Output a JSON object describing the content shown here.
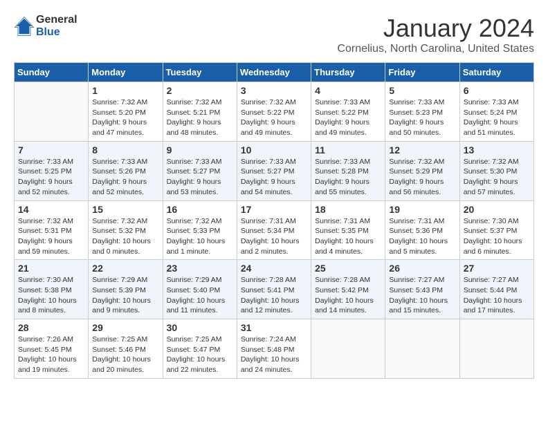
{
  "logo": {
    "text_general": "General",
    "text_blue": "Blue"
  },
  "title": "January 2024",
  "location": "Cornelius, North Carolina, United States",
  "days_of_week": [
    "Sunday",
    "Monday",
    "Tuesday",
    "Wednesday",
    "Thursday",
    "Friday",
    "Saturday"
  ],
  "weeks": [
    [
      {
        "day": "",
        "sunrise": "",
        "sunset": "",
        "daylight": ""
      },
      {
        "day": "1",
        "sunrise": "Sunrise: 7:32 AM",
        "sunset": "Sunset: 5:20 PM",
        "daylight": "Daylight: 9 hours and 47 minutes."
      },
      {
        "day": "2",
        "sunrise": "Sunrise: 7:32 AM",
        "sunset": "Sunset: 5:21 PM",
        "daylight": "Daylight: 9 hours and 48 minutes."
      },
      {
        "day": "3",
        "sunrise": "Sunrise: 7:32 AM",
        "sunset": "Sunset: 5:22 PM",
        "daylight": "Daylight: 9 hours and 49 minutes."
      },
      {
        "day": "4",
        "sunrise": "Sunrise: 7:33 AM",
        "sunset": "Sunset: 5:22 PM",
        "daylight": "Daylight: 9 hours and 49 minutes."
      },
      {
        "day": "5",
        "sunrise": "Sunrise: 7:33 AM",
        "sunset": "Sunset: 5:23 PM",
        "daylight": "Daylight: 9 hours and 50 minutes."
      },
      {
        "day": "6",
        "sunrise": "Sunrise: 7:33 AM",
        "sunset": "Sunset: 5:24 PM",
        "daylight": "Daylight: 9 hours and 51 minutes."
      }
    ],
    [
      {
        "day": "7",
        "sunrise": "Sunrise: 7:33 AM",
        "sunset": "Sunset: 5:25 PM",
        "daylight": "Daylight: 9 hours and 52 minutes."
      },
      {
        "day": "8",
        "sunrise": "Sunrise: 7:33 AM",
        "sunset": "Sunset: 5:26 PM",
        "daylight": "Daylight: 9 hours and 52 minutes."
      },
      {
        "day": "9",
        "sunrise": "Sunrise: 7:33 AM",
        "sunset": "Sunset: 5:27 PM",
        "daylight": "Daylight: 9 hours and 53 minutes."
      },
      {
        "day": "10",
        "sunrise": "Sunrise: 7:33 AM",
        "sunset": "Sunset: 5:27 PM",
        "daylight": "Daylight: 9 hours and 54 minutes."
      },
      {
        "day": "11",
        "sunrise": "Sunrise: 7:33 AM",
        "sunset": "Sunset: 5:28 PM",
        "daylight": "Daylight: 9 hours and 55 minutes."
      },
      {
        "day": "12",
        "sunrise": "Sunrise: 7:32 AM",
        "sunset": "Sunset: 5:29 PM",
        "daylight": "Daylight: 9 hours and 56 minutes."
      },
      {
        "day": "13",
        "sunrise": "Sunrise: 7:32 AM",
        "sunset": "Sunset: 5:30 PM",
        "daylight": "Daylight: 9 hours and 57 minutes."
      }
    ],
    [
      {
        "day": "14",
        "sunrise": "Sunrise: 7:32 AM",
        "sunset": "Sunset: 5:31 PM",
        "daylight": "Daylight: 9 hours and 59 minutes."
      },
      {
        "day": "15",
        "sunrise": "Sunrise: 7:32 AM",
        "sunset": "Sunset: 5:32 PM",
        "daylight": "Daylight: 10 hours and 0 minutes."
      },
      {
        "day": "16",
        "sunrise": "Sunrise: 7:32 AM",
        "sunset": "Sunset: 5:33 PM",
        "daylight": "Daylight: 10 hours and 1 minute."
      },
      {
        "day": "17",
        "sunrise": "Sunrise: 7:31 AM",
        "sunset": "Sunset: 5:34 PM",
        "daylight": "Daylight: 10 hours and 2 minutes."
      },
      {
        "day": "18",
        "sunrise": "Sunrise: 7:31 AM",
        "sunset": "Sunset: 5:35 PM",
        "daylight": "Daylight: 10 hours and 4 minutes."
      },
      {
        "day": "19",
        "sunrise": "Sunrise: 7:31 AM",
        "sunset": "Sunset: 5:36 PM",
        "daylight": "Daylight: 10 hours and 5 minutes."
      },
      {
        "day": "20",
        "sunrise": "Sunrise: 7:30 AM",
        "sunset": "Sunset: 5:37 PM",
        "daylight": "Daylight: 10 hours and 6 minutes."
      }
    ],
    [
      {
        "day": "21",
        "sunrise": "Sunrise: 7:30 AM",
        "sunset": "Sunset: 5:38 PM",
        "daylight": "Daylight: 10 hours and 8 minutes."
      },
      {
        "day": "22",
        "sunrise": "Sunrise: 7:29 AM",
        "sunset": "Sunset: 5:39 PM",
        "daylight": "Daylight: 10 hours and 9 minutes."
      },
      {
        "day": "23",
        "sunrise": "Sunrise: 7:29 AM",
        "sunset": "Sunset: 5:40 PM",
        "daylight": "Daylight: 10 hours and 11 minutes."
      },
      {
        "day": "24",
        "sunrise": "Sunrise: 7:28 AM",
        "sunset": "Sunset: 5:41 PM",
        "daylight": "Daylight: 10 hours and 12 minutes."
      },
      {
        "day": "25",
        "sunrise": "Sunrise: 7:28 AM",
        "sunset": "Sunset: 5:42 PM",
        "daylight": "Daylight: 10 hours and 14 minutes."
      },
      {
        "day": "26",
        "sunrise": "Sunrise: 7:27 AM",
        "sunset": "Sunset: 5:43 PM",
        "daylight": "Daylight: 10 hours and 15 minutes."
      },
      {
        "day": "27",
        "sunrise": "Sunrise: 7:27 AM",
        "sunset": "Sunset: 5:44 PM",
        "daylight": "Daylight: 10 hours and 17 minutes."
      }
    ],
    [
      {
        "day": "28",
        "sunrise": "Sunrise: 7:26 AM",
        "sunset": "Sunset: 5:45 PM",
        "daylight": "Daylight: 10 hours and 19 minutes."
      },
      {
        "day": "29",
        "sunrise": "Sunrise: 7:25 AM",
        "sunset": "Sunset: 5:46 PM",
        "daylight": "Daylight: 10 hours and 20 minutes."
      },
      {
        "day": "30",
        "sunrise": "Sunrise: 7:25 AM",
        "sunset": "Sunset: 5:47 PM",
        "daylight": "Daylight: 10 hours and 22 minutes."
      },
      {
        "day": "31",
        "sunrise": "Sunrise: 7:24 AM",
        "sunset": "Sunset: 5:48 PM",
        "daylight": "Daylight: 10 hours and 24 minutes."
      },
      {
        "day": "",
        "sunrise": "",
        "sunset": "",
        "daylight": ""
      },
      {
        "day": "",
        "sunrise": "",
        "sunset": "",
        "daylight": ""
      },
      {
        "day": "",
        "sunrise": "",
        "sunset": "",
        "daylight": ""
      }
    ]
  ]
}
